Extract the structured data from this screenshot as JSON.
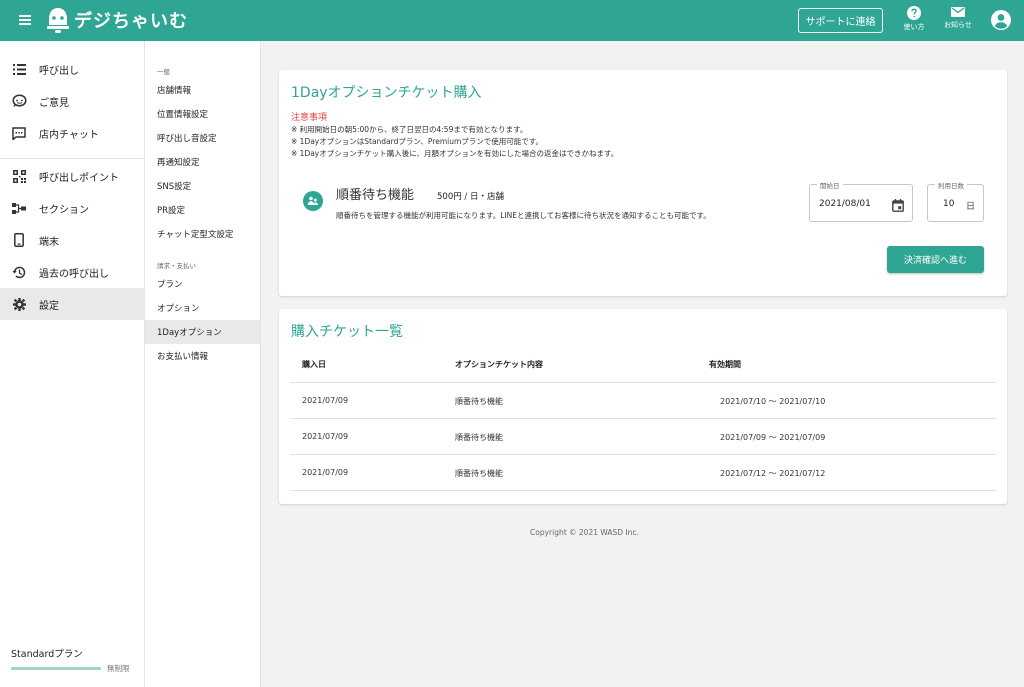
{
  "header": {
    "logo_text": "デジちゃいむ",
    "support_label": "サポートに連絡",
    "help_label": "使い方",
    "notice_label": "お知らせ"
  },
  "nav": {
    "items": [
      {
        "label": "呼び出し",
        "icon": "list-icon"
      },
      {
        "label": "ご意見",
        "icon": "feedback-icon"
      },
      {
        "label": "店内チャット",
        "icon": "chat-icon"
      },
      {
        "label": "呼び出しポイント",
        "icon": "qr-code-icon"
      },
      {
        "label": "セクション",
        "icon": "section-icon"
      },
      {
        "label": "端末",
        "icon": "device-icon"
      },
      {
        "label": "過去の呼び出し",
        "icon": "history-icon"
      },
      {
        "label": "設定",
        "icon": "gear-icon"
      }
    ],
    "plan_name": "Standardプラン",
    "plan_limit": "無制限",
    "plan_usage": 1.0
  },
  "subnav": {
    "general_head": "一般",
    "general_items": [
      "店舗情報",
      "位置情報設定",
      "呼び出し音設定",
      "再通知設定",
      "SNS設定",
      "PR設定",
      "チャット定型文設定"
    ],
    "billing_head": "請求・支払い",
    "billing_items": [
      "プラン",
      "オプション",
      "1Dayオプション",
      "お支払い情報"
    ]
  },
  "purchase": {
    "title": "1Dayオプションチケット購入",
    "notice_title": "注意事項",
    "notices": [
      "※ 利用開始日の朝5:00から、終了日翌日の4:59まで有効となります。",
      "※ 1DayオプションはStandardプラン、Premiumプランで使用可能です。",
      "※ 1Dayオプションチケット購入後に、月額オプションを有効にした場合の返金はできかねます。"
    ],
    "feature_name": "順番待ち機能",
    "feature_price": "500円 / 日・店舗",
    "feature_desc": "順番待ちを管理する機能が利用可能になります。LINEと連携してお客様に待ち状況を通知することも可能です。",
    "start_label": "開始日",
    "start_value": "2021/08/01",
    "days_label": "利用日数",
    "days_value": "10",
    "days_unit": "日",
    "proceed_label": "決済確認へ進む"
  },
  "tickets": {
    "title": "購入チケット一覧",
    "columns": [
      "購入日",
      "オプションチケット内容",
      "有効期間"
    ],
    "rows": [
      [
        "2021/07/09",
        "順番待ち機能",
        "2021/07/10 〜 2021/07/10"
      ],
      [
        "2021/07/09",
        "順番待ち機能",
        "2021/07/09 〜 2021/07/09"
      ],
      [
        "2021/07/09",
        "順番待ち機能",
        "2021/07/12 〜 2021/07/12"
      ]
    ]
  },
  "footer": {
    "copyright": "Copyright © 2021 WASD Inc."
  },
  "colors": {
    "brand": "#2fa593",
    "notice": "#e04848"
  }
}
